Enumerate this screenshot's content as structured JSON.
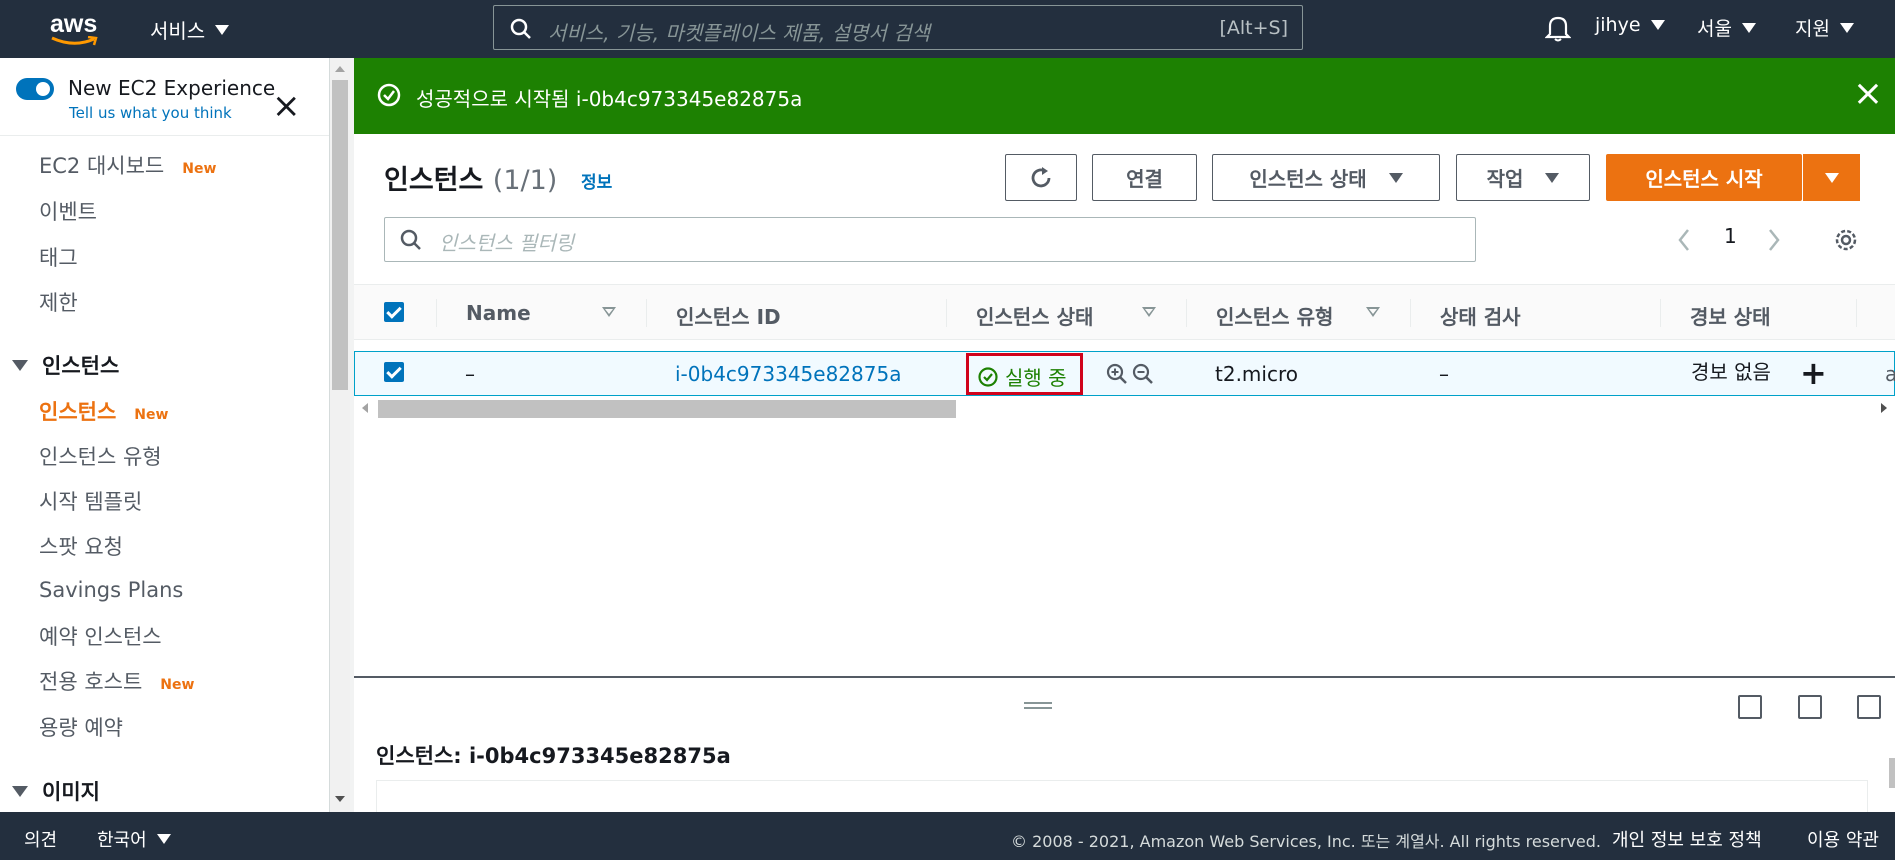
{
  "topnav": {
    "logo_text": "aws",
    "services": "서비스",
    "search_placeholder": "서비스, 기능, 마켓플레이스 제품, 설명서 검색",
    "search_hint": "[Alt+S]",
    "user": "jihye",
    "region": "서울",
    "support": "지원"
  },
  "sidebar": {
    "experience_title": "New EC2 Experience",
    "experience_link": "Tell us what you think",
    "new_badge": "New",
    "items": [
      {
        "label": "EC2 대시보드"
      },
      {
        "label": "이벤트"
      },
      {
        "label": "태그"
      },
      {
        "label": "제한"
      }
    ],
    "section_instances": "인스턴스",
    "instances_items": [
      {
        "label": "인스턴스"
      },
      {
        "label": "인스턴스 유형"
      },
      {
        "label": "시작 템플릿"
      },
      {
        "label": "스팟 요청"
      },
      {
        "label": "Savings Plans"
      },
      {
        "label": "예약 인스턴스"
      },
      {
        "label": "전용 호스트"
      },
      {
        "label": "용량 예약"
      }
    ],
    "section_images": "이미지"
  },
  "flash": {
    "message": "성공적으로 시작됨 i-0b4c973345e82875a"
  },
  "main": {
    "title": "인스턴스",
    "count": "(1/1)",
    "info": "정보",
    "btn_connect": "연결",
    "btn_state": "인스턴스 상태",
    "btn_actions": "작업",
    "btn_launch": "인스턴스 시작",
    "filter_placeholder": "인스턴스 필터링",
    "page": "1"
  },
  "table": {
    "columns": [
      "Name",
      "인스턴스 ID",
      "인스턴스 상태",
      "인스턴스 유형",
      "상태 검사",
      "경보 상태"
    ],
    "row": {
      "name": "–",
      "instance_id": "i-0b4c973345e82875a",
      "state": "실행 중",
      "type": "t2.micro",
      "status_check": "–",
      "alarm": "경보 없음",
      "cut_char": "a"
    }
  },
  "split_panel": {
    "title": "인스턴스: i-0b4c973345e82875a"
  },
  "footer": {
    "feedback": "의견",
    "language": "한국어",
    "copyright": "© 2008 - 2021, Amazon Web Services, Inc. 또는 계열사. All rights reserved.",
    "privacy": "개인 정보 보호 정책",
    "terms": "이용 약관"
  },
  "colors": {
    "nav_bg": "#232f3e",
    "accent_orange": "#ec7211",
    "success_green": "#1d8102",
    "link_blue": "#0073bb",
    "highlight_red": "#d0021b"
  }
}
